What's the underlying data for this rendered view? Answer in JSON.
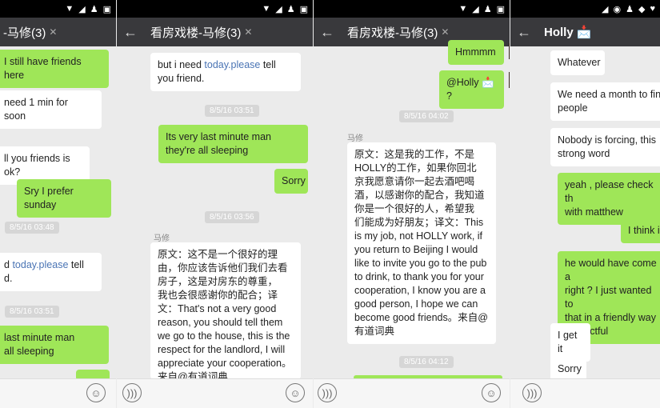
{
  "status": {
    "icons": [
      "wifi-icon",
      "signal-icon",
      "r-icon",
      "snapchat-icon",
      "image-icon"
    ]
  },
  "p1": {
    "title": "-马修(3)",
    "items": {
      "m1": "I still have friends here",
      "m2": "need 1 min for\nsoon",
      "m3": "ll you friends is ok?",
      "m4": "Sry I prefer sunday",
      "t1": "8/5/16 03:48",
      "m5a": "d ",
      "m5b": "today.please",
      "m5c": " tell\nd.",
      "t2": "8/5/16 03:51",
      "m6": "last minute man\nall sleeping"
    }
  },
  "p2": {
    "title": "看房戏楼-马修(3)",
    "items": {
      "m1a": "but i need ",
      "m1b": "today.please",
      "m1c": " tell\nyou friend.",
      "t1": "8/5/16 03:51",
      "m2": "Its very last minute man\nthey're all sleeping",
      "m3": "Sorry",
      "t2": "8/5/16 03:56",
      "sender": "马修",
      "m4": "原文：这不是一个很好的理\n由，你应该告诉他们我们去看\n房子，这是对房东的尊重，\n我也会很感谢你的配合；译\n文：That's not a very good\nreason, you should tell them\nwe go to the house, this is the\nrespect for the landlord, I will\nappreciate your cooperation。\n来自@有道词典"
    }
  },
  "p3": {
    "title": "看房戏楼-马修(3)",
    "items": {
      "m1": "Hmmmm",
      "m2": "@Holly 📩 ?",
      "t1": "8/5/16 04:02",
      "sender": "马修",
      "m3": "原文：这是我的工作，不是\nHOLLY的工作，如果你回北\n京我愿意请你一起去酒吧喝\n酒，以感谢你的配合，我知道\n你是一个很好的人，希望我\n们能成为好朋友；译文：This\nis my job, not HOLLY work, if\nyou return to Beijing I would\nlike to invite you go to the pub\nto drink, to thank you for your\ncooperation, I know you are a\ngood person, I hope we can\nbecome good friends。来自@\n有道词典",
      "t2": "8/5/16 04:12"
    }
  },
  "p4": {
    "title": "Holly 📩",
    "items": {
      "m1": "Whatever",
      "m2": "We need a month to fin\npeople",
      "m3": "Nobody is forcing, this\nstrong word",
      "m4": "yeah , please check th\nwith matthew",
      "m5": "I think i",
      "m6": "he would have come a\nright ? I just wanted to\nthat in a friendly way\nrespectful",
      "m7": "I get it",
      "m8": "Sorry"
    }
  },
  "icons": {
    "back": "←",
    "mute": "🔕",
    "emoji": "☺",
    "voice": "🔊"
  }
}
